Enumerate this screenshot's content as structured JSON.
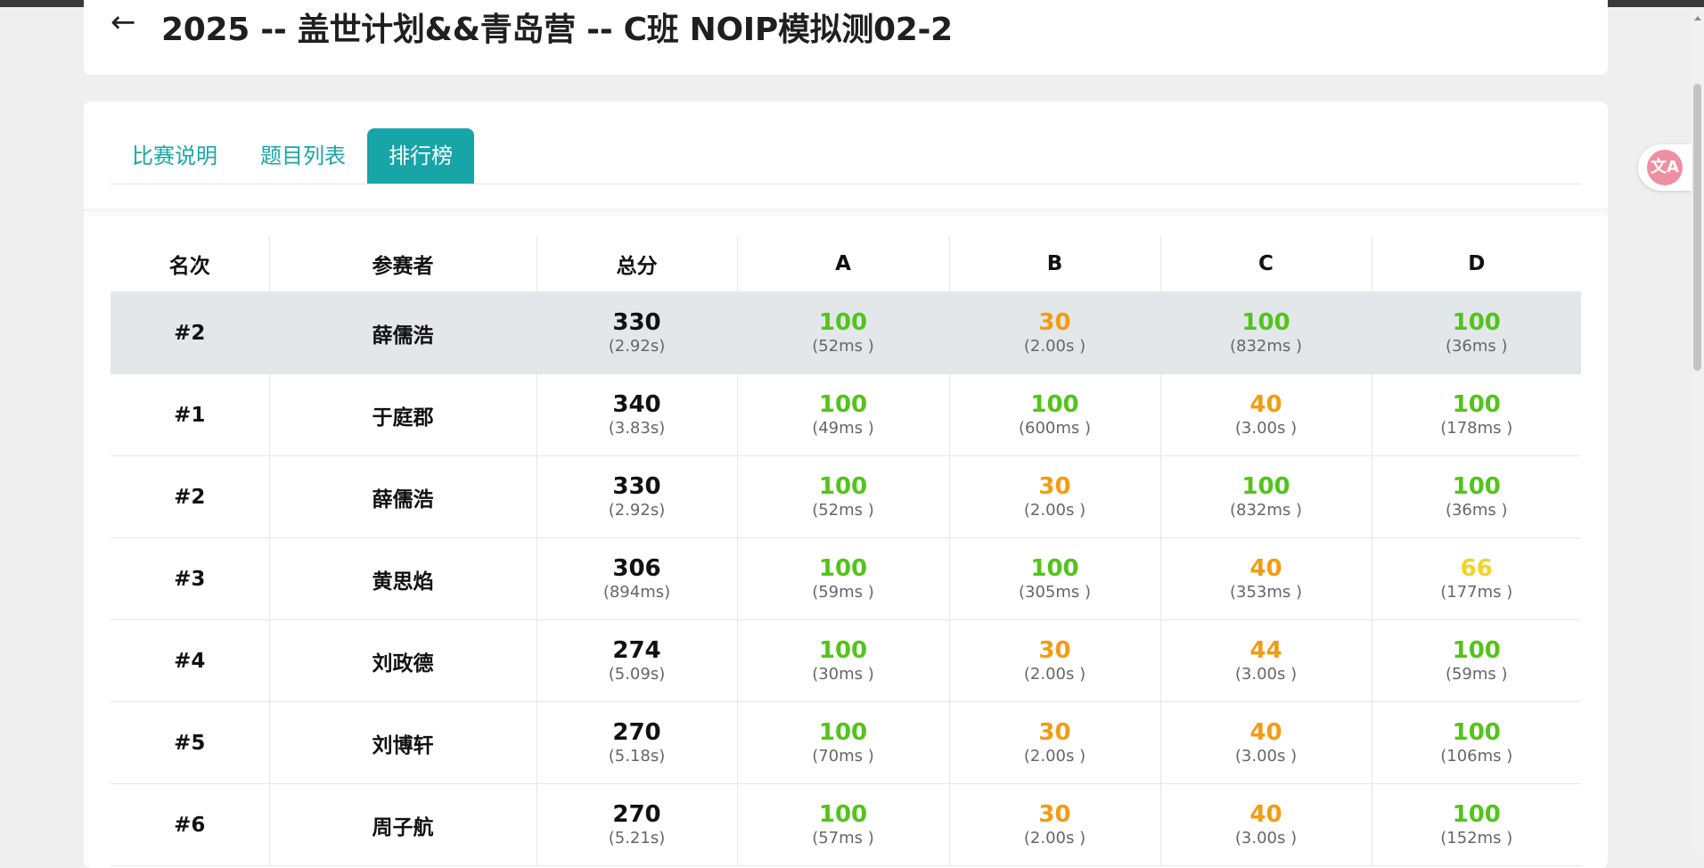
{
  "header": {
    "back_icon": "arrow-left-icon",
    "title": "2025 -- 盖世计划&&青岛营 -- C班 NOIP模拟测02-2"
  },
  "tabs": [
    {
      "label": "比赛说明",
      "active": false
    },
    {
      "label": "题目列表",
      "active": false
    },
    {
      "label": "排行榜",
      "active": true
    }
  ],
  "table": {
    "headers": [
      "名次",
      "参赛者",
      "总分",
      "A",
      "B",
      "C",
      "D"
    ],
    "rows": [
      {
        "rank": "#2",
        "name": "薛儒浩",
        "highlight": true,
        "total": {
          "score": "330",
          "time": "(2.92s)"
        },
        "problems": [
          {
            "score": "100",
            "time": "(52ms )",
            "color": "green"
          },
          {
            "score": "30",
            "time": "(2.00s )",
            "color": "orange"
          },
          {
            "score": "100",
            "time": "(832ms )",
            "color": "green"
          },
          {
            "score": "100",
            "time": "(36ms )",
            "color": "green"
          }
        ]
      },
      {
        "rank": "#1",
        "name": "于庭郡",
        "highlight": false,
        "total": {
          "score": "340",
          "time": "(3.83s)"
        },
        "problems": [
          {
            "score": "100",
            "time": "(49ms )",
            "color": "green"
          },
          {
            "score": "100",
            "time": "(600ms )",
            "color": "green"
          },
          {
            "score": "40",
            "time": "(3.00s )",
            "color": "orange"
          },
          {
            "score": "100",
            "time": "(178ms )",
            "color": "green"
          }
        ]
      },
      {
        "rank": "#2",
        "name": "薛儒浩",
        "highlight": false,
        "total": {
          "score": "330",
          "time": "(2.92s)"
        },
        "problems": [
          {
            "score": "100",
            "time": "(52ms )",
            "color": "green"
          },
          {
            "score": "30",
            "time": "(2.00s )",
            "color": "orange"
          },
          {
            "score": "100",
            "time": "(832ms )",
            "color": "green"
          },
          {
            "score": "100",
            "time": "(36ms )",
            "color": "green"
          }
        ]
      },
      {
        "rank": "#3",
        "name": "黄思焰",
        "highlight": false,
        "total": {
          "score": "306",
          "time": "(894ms)"
        },
        "problems": [
          {
            "score": "100",
            "time": "(59ms )",
            "color": "green"
          },
          {
            "score": "100",
            "time": "(305ms )",
            "color": "green"
          },
          {
            "score": "40",
            "time": "(353ms )",
            "color": "orange"
          },
          {
            "score": "66",
            "time": "(177ms )",
            "color": "yellow"
          }
        ]
      },
      {
        "rank": "#4",
        "name": "刘政德",
        "highlight": false,
        "total": {
          "score": "274",
          "time": "(5.09s)"
        },
        "problems": [
          {
            "score": "100",
            "time": "(30ms )",
            "color": "green"
          },
          {
            "score": "30",
            "time": "(2.00s )",
            "color": "orange"
          },
          {
            "score": "44",
            "time": "(3.00s )",
            "color": "orange"
          },
          {
            "score": "100",
            "time": "(59ms )",
            "color": "green"
          }
        ]
      },
      {
        "rank": "#5",
        "name": "刘博轩",
        "highlight": false,
        "total": {
          "score": "270",
          "time": "(5.18s)"
        },
        "problems": [
          {
            "score": "100",
            "time": "(70ms )",
            "color": "green"
          },
          {
            "score": "30",
            "time": "(2.00s )",
            "color": "orange"
          },
          {
            "score": "40",
            "time": "(3.00s )",
            "color": "orange"
          },
          {
            "score": "100",
            "time": "(106ms )",
            "color": "green"
          }
        ]
      },
      {
        "rank": "#6",
        "name": "周子航",
        "highlight": false,
        "total": {
          "score": "270",
          "time": "(5.21s)"
        },
        "problems": [
          {
            "score": "100",
            "time": "(57ms )",
            "color": "green"
          },
          {
            "score": "30",
            "time": "(2.00s )",
            "color": "orange"
          },
          {
            "score": "40",
            "time": "(3.00s )",
            "color": "orange"
          },
          {
            "score": "100",
            "time": "(152ms )",
            "color": "green"
          }
        ]
      }
    ]
  },
  "colors": {
    "accent": "#17a5a8",
    "green": "#52c41a",
    "orange": "#f39c12",
    "yellow": "#f5d322",
    "highlight_row": "#e4e7ea"
  },
  "translate_badge": {
    "icon": "translate-icon",
    "glyph": "文A"
  }
}
